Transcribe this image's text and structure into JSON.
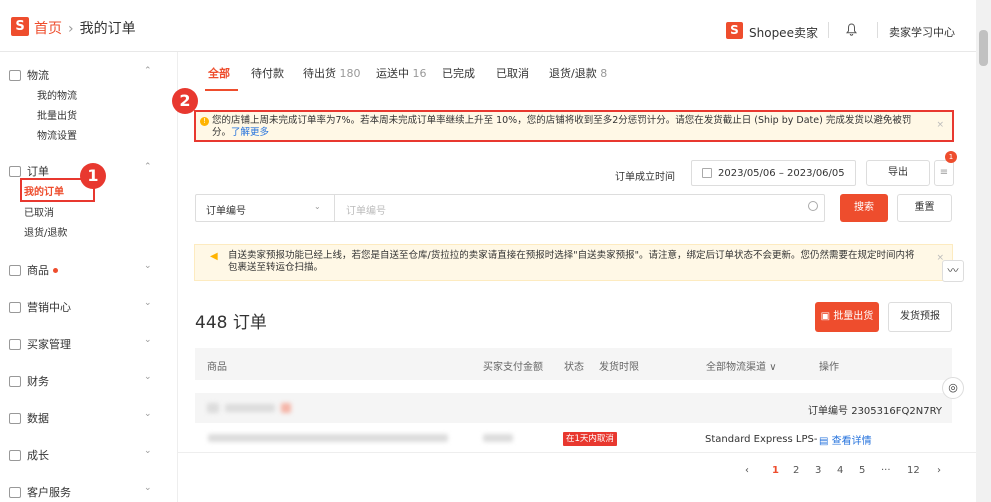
{
  "header": {
    "logo_glyph": "S",
    "breadcrumb": [
      "首页",
      "我的订单"
    ],
    "breadcrumb_sep": "›",
    "seller_center": "Shopee卖家",
    "learning_center": "卖家学习中心"
  },
  "sidebar": {
    "sections": [
      {
        "label": "物流",
        "icon": "truck-icon",
        "expanded": true,
        "chevron": "⌃",
        "items": [
          "我的物流",
          "批量出货",
          "物流设置"
        ]
      },
      {
        "label": "订单",
        "icon": "clipboard-icon",
        "expanded": true,
        "chevron": "⌃",
        "items": [
          "我的订单",
          "已取消",
          "退货/退款"
        ],
        "active_item": "我的订单"
      },
      {
        "label": "商品",
        "icon": "box-icon",
        "chevron": "⌄",
        "has_dot": true
      },
      {
        "label": "营销中心",
        "icon": "tag-icon",
        "chevron": "⌄"
      },
      {
        "label": "买家管理",
        "icon": "users-icon",
        "chevron": "⌄"
      },
      {
        "label": "财务",
        "icon": "wallet-icon",
        "chevron": "⌄"
      },
      {
        "label": "数据",
        "icon": "chart-icon",
        "chevron": "⌄"
      },
      {
        "label": "成长",
        "icon": "growth-icon",
        "chevron": "⌄"
      },
      {
        "label": "客户服务",
        "icon": "support-icon",
        "chevron": "⌄"
      }
    ]
  },
  "annotations": {
    "step1": "1",
    "step2": "2"
  },
  "tabs": [
    {
      "label": "全部",
      "active": true
    },
    {
      "label": "待付款"
    },
    {
      "label": "待出货",
      "count": "180"
    },
    {
      "label": "运送中",
      "count": "16"
    },
    {
      "label": "已完成"
    },
    {
      "label": "已取消"
    },
    {
      "label": "退货/退款",
      "count": "8"
    }
  ],
  "alert_penalty": {
    "text": "您的店铺上周未完成订单率为7%。若本周未完成订单率继续上升至 10%，您的店铺将收到至多2分惩罚计分。请您在发货截止日 (Ship by Date) 完成发货以避免被罚分。",
    "link": "了解更多",
    "icon_glyph": "!"
  },
  "filters": {
    "order_time_label": "订单成立时间",
    "date_range": "2023/05/06 – 2023/06/05",
    "export_label": "导出",
    "export_badge": "1",
    "search_field": "订单编号",
    "search_placeholder": "订单编号",
    "search_button": "搜索",
    "reset_button": "重置",
    "chevron": "⌄",
    "menu_glyph": "≡"
  },
  "alert_self_ship": {
    "text": "自送卖家预报功能已经上线，若您是自送至仓库/货拉拉的卖家请直接在预报时选择\"自送卖家预报\"。请注意，绑定后订单状态不会更新。您仍然需要在规定时间内将包裹送至转运仓扫描。",
    "icon_glyph": "◀"
  },
  "orders": {
    "count_title": "448 订单",
    "bulk_ship": "批量出货",
    "ship_forecast": "发货预报",
    "columns": [
      "商品",
      "买家支付金额",
      "状态",
      "发货时限",
      "全部物流渠道",
      "操作"
    ],
    "column_chevron": "∨",
    "first_order": {
      "order_no": "订单编号 2305316FQ2N7RY",
      "status_tag": "在1天内取消",
      "logistics": "Standard Express LPS-",
      "action": "查看详情"
    }
  },
  "pagination": {
    "prev": "‹",
    "pages": [
      "1",
      "2",
      "3",
      "4",
      "5",
      "···",
      "12"
    ],
    "next": "›",
    "current": "1"
  },
  "float_buttons": {
    "monitor": "〰",
    "support": "◎"
  },
  "close_glyph": "×",
  "colors": {
    "brand": "#ee4d2d",
    "annotation": "#e8382f",
    "link": "#2673dd",
    "warning_bg": "#fff8e6"
  }
}
